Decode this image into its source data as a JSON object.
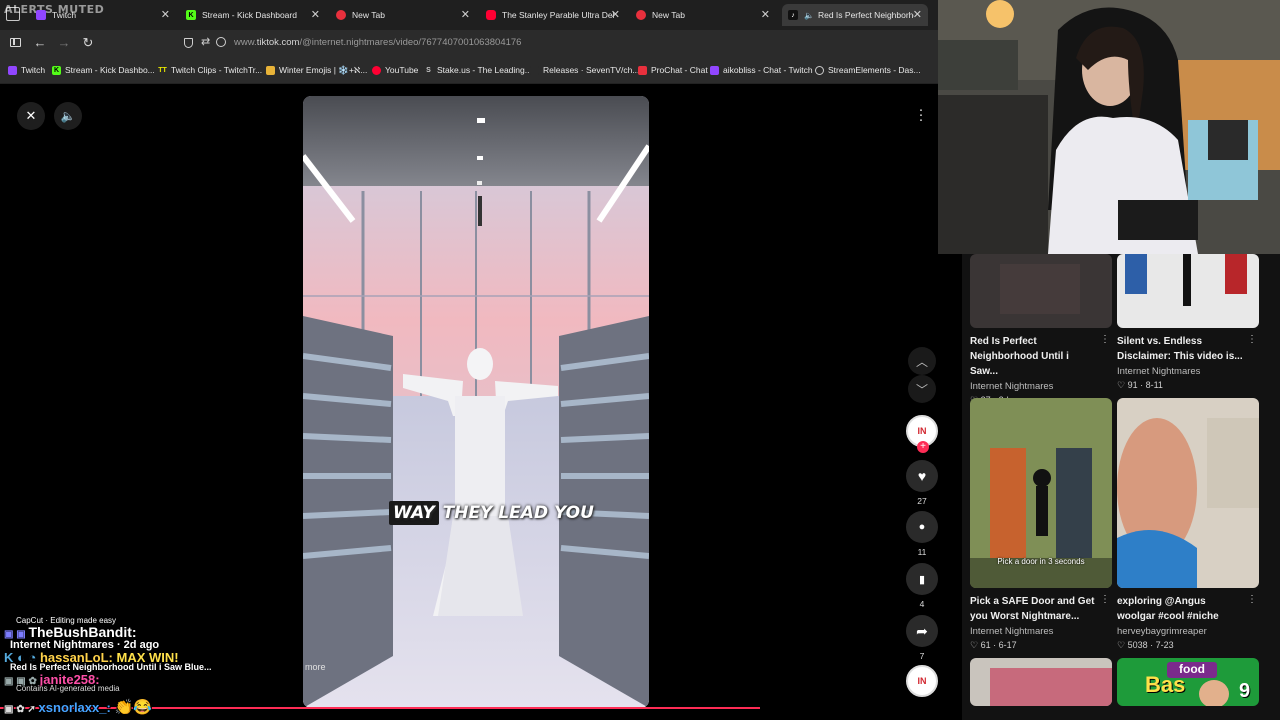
{
  "stream_overlay": {
    "alerts": "ALERTS MUTED"
  },
  "tabs": [
    {
      "label": "Twitch",
      "favicon": "twitch-icon",
      "color": "#9146ff"
    },
    {
      "label": "Stream - Kick Dashboard",
      "favicon": "kick-icon",
      "color": "#53fc18"
    },
    {
      "label": "New Tab",
      "favicon": "opera-icon",
      "color": "#e8303d"
    },
    {
      "label": "The Stanley Parable Ultra Delux",
      "favicon": "youtube-icon",
      "color": "#ff0033"
    },
    {
      "label": "New Tab",
      "favicon": "opera-icon",
      "color": "#e8303d"
    },
    {
      "label": "Red Is Perfect Neighborhoo",
      "favicon": "tiktok-icon",
      "color": "#ffffff"
    }
  ],
  "address": {
    "host": "www.",
    "domain": "tiktok.com",
    "path": "/@internet.nightmares/video/7677407001063804176"
  },
  "bookmarks": [
    {
      "label": "Twitch",
      "icon": "twitch-icon",
      "color": "#9146ff"
    },
    {
      "label": "Stream - Kick Dashbo...",
      "icon": "kick-icon",
      "color": "#53fc18"
    },
    {
      "label": "Twitch Clips - TwitchTr...",
      "icon": "twitchtracker-icon",
      "color": "#e6e600"
    },
    {
      "label": "Winter Emojis | ❄️+ℵ...",
      "icon": "folder-icon",
      "color": "#e8b338"
    },
    {
      "label": "YouTube",
      "icon": "youtube-icon",
      "color": "#ff0033"
    },
    {
      "label": "Stake.us - The Leading...",
      "icon": "stake-icon",
      "color": "#cccccc"
    },
    {
      "label": "Releases · SevenTV/ch...",
      "icon": "github-icon",
      "color": "#ffffff"
    },
    {
      "label": "ProChat - Chat",
      "icon": "prochat-icon",
      "color": "#e8303d"
    },
    {
      "label": "aikobliss - Chat - Twitch",
      "icon": "twitch-icon",
      "color": "#9146ff"
    },
    {
      "label": "StreamElements - Das...",
      "icon": "streamelements-icon",
      "color": "#cccccc"
    }
  ],
  "video": {
    "caption_highlight": "WAY",
    "caption_rest": "THEY LEAD YOU",
    "more": "more"
  },
  "actions": {
    "likes": "27",
    "comments": "11",
    "saves": "4",
    "shares": "7",
    "avatar_text": "IN"
  },
  "videos": [
    {
      "title": "Red Is Perfect Neighborhood Until i Saw...",
      "author": "Internet Nightmares",
      "likes": "27",
      "date": "2d ago"
    },
    {
      "title": "Silent vs. Endless Disclaimer: This video is...",
      "author": "Internet Nightmares",
      "likes": "91",
      "date": "8-11"
    },
    {
      "title": "Pick a SAFE Door and Get you Worst Nightmare...",
      "author": "Internet Nightmares",
      "likes": "61",
      "date": "6-17",
      "thumb_caption": "Pick a door in 3 seconds"
    },
    {
      "title": "exploring @Angus woolgar #cool #niche",
      "author": "herveybaygrimreaper",
      "likes": "5038",
      "date": "7-23"
    }
  ],
  "chat": {
    "capcut": "CapCut · Editing made easy",
    "user1": "TheBushBandit:",
    "line2": "Internet Nightmares · 2d ago",
    "user2": "hassanLoL:",
    "msg2": "MAX WIN!",
    "line4": "Red Is Perfect Neighborhood Until i Saw Blue...",
    "user3": "janite258:",
    "line6": "Contains AI-generated media",
    "user4": "xsnorlaxx_:"
  },
  "bottom_thumbs": {
    "food_text": "food",
    "bas_text": "Bas",
    "number": "9"
  }
}
